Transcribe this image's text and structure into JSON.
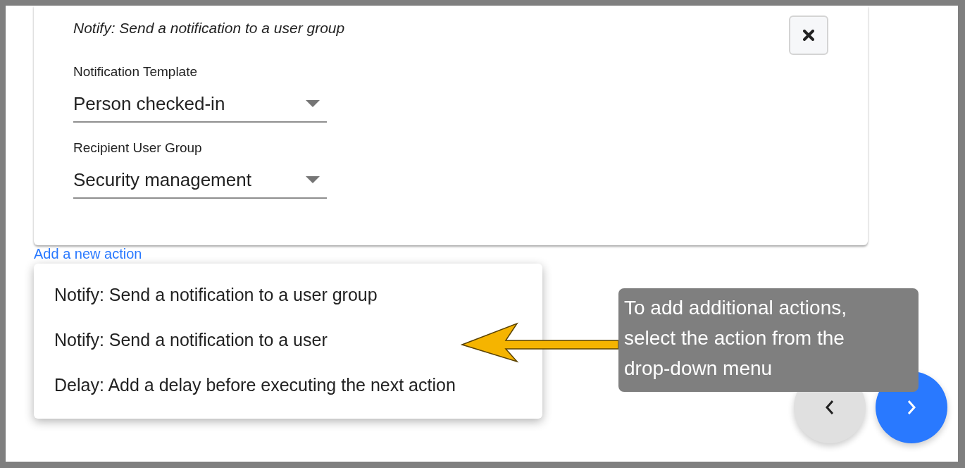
{
  "action_card": {
    "title": "Notify: Send a notification to a user group",
    "fields": [
      {
        "label": "Notification Template",
        "value": "Person checked-in"
      },
      {
        "label": "Recipient User Group",
        "value": "Security management"
      }
    ]
  },
  "add_action_link": "Add a new action",
  "action_menu": [
    {
      "label": "Notify: Send a notification to a user group"
    },
    {
      "label": "Notify: Send a notification to a user"
    },
    {
      "label": "Delay: Add a delay before executing the next action"
    }
  ],
  "callout": "To add additional actions, select the action from the drop-down menu"
}
